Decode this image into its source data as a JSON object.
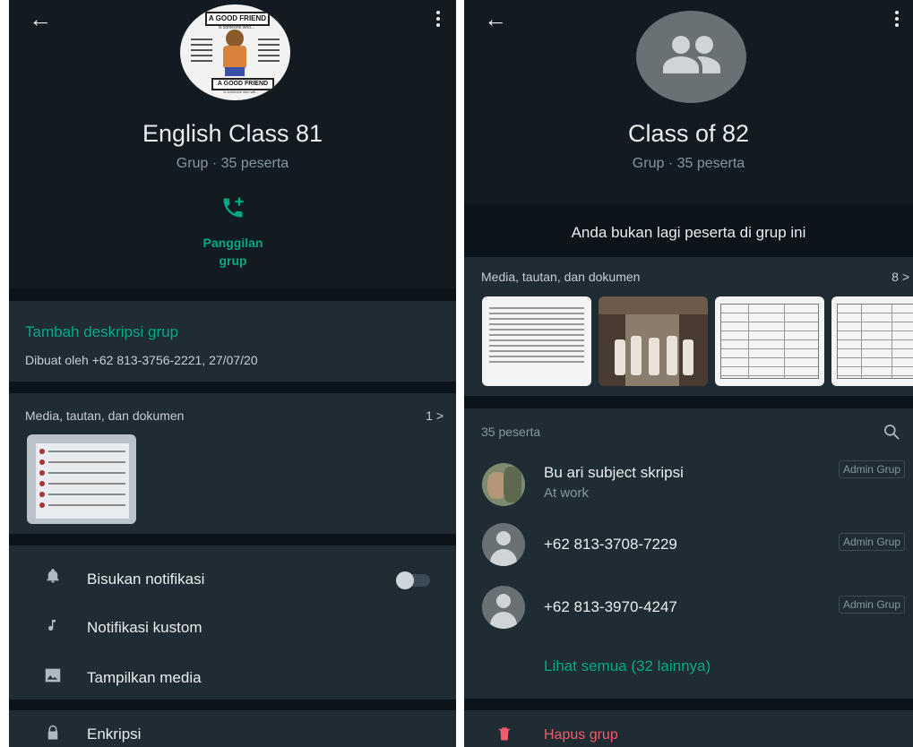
{
  "left": {
    "group_name": "English Class 81",
    "group_meta": "Grup · 35 peserta",
    "avatar": {
      "top_text": "A GOOD FRIEND",
      "top_sub": "is someone who...",
      "bottom_text": "A GOOD FRIEND",
      "bottom_sub": "is someone who will..."
    },
    "call": {
      "label_1": "Panggilan",
      "label_2": "grup"
    },
    "add_description": "Tambah deskripsi grup",
    "created_by": "Dibuat oleh +62 813-3756-2221, 27/07/20",
    "media": {
      "title": "Media, tautan, dan dokumen",
      "count": "1 >"
    },
    "settings": [
      {
        "label": "Bisukan notifikasi",
        "icon": "bell-icon"
      },
      {
        "label": "Notifikasi kustom",
        "icon": "music-note-icon"
      },
      {
        "label": "Tampilkan media",
        "icon": "image-icon"
      }
    ],
    "encryption": "Enkripsi"
  },
  "right": {
    "group_name": "Class of 82",
    "group_meta": "Grup · 35 peserta",
    "notice": "Anda bukan lagi peserta di grup ini",
    "media": {
      "title": "Media, tautan, dan dokumen",
      "count": "8 >"
    },
    "participants_count": "35 peserta",
    "participants": [
      {
        "name": "Bu ari subject skripsi",
        "status": "At work",
        "badge": "Admin Grup"
      },
      {
        "name": "+62 813-3708-7229",
        "status": "",
        "badge": "Admin Grup"
      },
      {
        "name": "+62 813-3970-4247",
        "status": "",
        "badge": "Admin Grup"
      }
    ],
    "see_all": "Lihat semua (32 lainnya)",
    "delete_group": "Hapus grup"
  },
  "colors": {
    "background": "#111b21",
    "section": "#1f2c34",
    "accent_green": "#00a884",
    "danger_red": "#f15c6d",
    "muted": "#8696a0"
  }
}
